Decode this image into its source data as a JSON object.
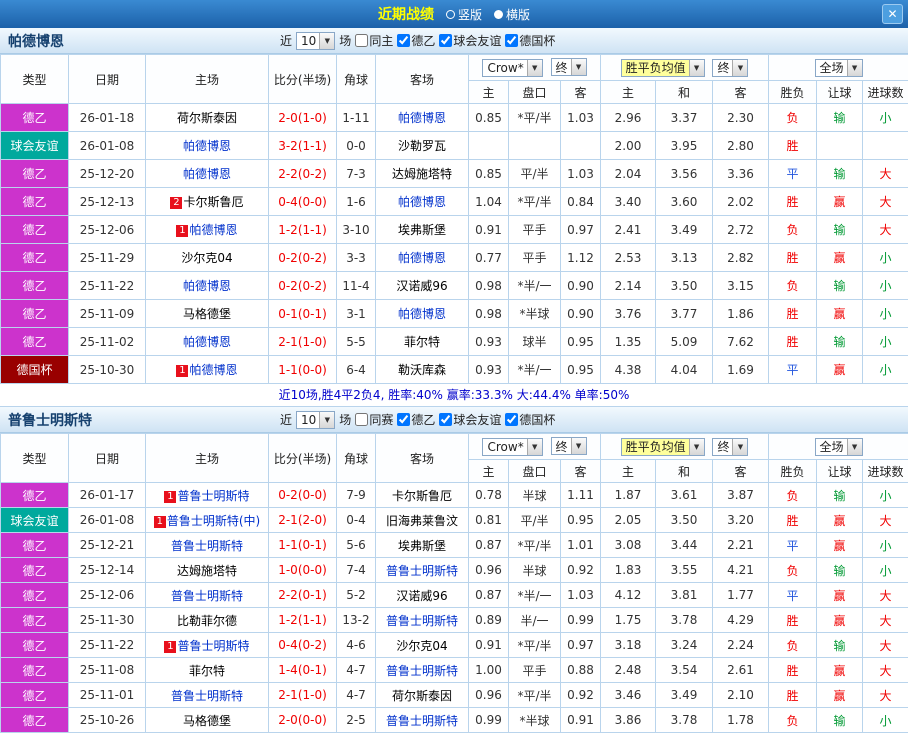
{
  "colors": {
    "accent_red": "#f00000",
    "accent_green": "#009933",
    "accent_blue": "#2255dd",
    "league_de2": "#cc33cc",
    "league_friendly": "#00a99d",
    "league_cup": "#990000",
    "focus_team": "#0030cc",
    "title_yellow": "#ffff00"
  },
  "titlebar": {
    "title": "近期战绩",
    "modes": [
      "竖版",
      "横版"
    ],
    "selected_mode": "横版",
    "close": "✕"
  },
  "controls": {
    "near": "近",
    "count": "10",
    "games": "场",
    "bookmaker": "Crow*",
    "final": "终",
    "wdl_avg": "胜平负均值",
    "full": "全场"
  },
  "columns": {
    "type": "类型",
    "date": "日期",
    "home": "主场",
    "score": "比分(半场)",
    "corner": "角球",
    "away": "客场",
    "ah_home": "主",
    "ah_line": "盘口",
    "ah_away": "客",
    "eu_home": "主",
    "eu_draw": "和",
    "eu_away": "客",
    "res_wdl": "胜负",
    "res_ah": "让球",
    "res_goal": "进球数"
  },
  "sections": [
    {
      "team": "帕德博恩",
      "same_label": "同主",
      "same_checked": false,
      "filters": [
        "德乙",
        "球会友谊",
        "德国杯"
      ],
      "filters_checked": [
        true,
        true,
        true
      ],
      "summary": "近10场,胜4平2负4, 胜率:40% 赢率:33.3% 大:44.4% 单率:50%",
      "rows": [
        {
          "type": "德乙",
          "date": "26-01-18",
          "home_rank": "",
          "home": "荷尔斯泰因",
          "home_focus": false,
          "score": "2-0(1-0)",
          "corner": "1-11",
          "away_rank": "",
          "away": "帕德博恩",
          "away_focus": true,
          "ah_home": "0.85",
          "ah_line": "*平/半",
          "ah_away": "1.03",
          "eu_home": "2.96",
          "eu_draw": "3.37",
          "eu_away": "2.30",
          "res_wdl": "负",
          "res_ah": "输",
          "res_goal": "小"
        },
        {
          "type": "球会友谊",
          "date": "26-01-08",
          "home_rank": "",
          "home": "帕德博恩",
          "home_focus": true,
          "score": "3-2(1-1)",
          "corner": "0-0",
          "away_rank": "",
          "away": "沙勒罗瓦",
          "away_focus": false,
          "ah_home": "",
          "ah_line": "",
          "ah_away": "",
          "eu_home": "2.00",
          "eu_draw": "3.95",
          "eu_away": "2.80",
          "res_wdl": "胜",
          "res_ah": "",
          "res_goal": ""
        },
        {
          "type": "德乙",
          "date": "25-12-20",
          "home_rank": "",
          "home": "帕德博恩",
          "home_focus": true,
          "score": "2-2(0-2)",
          "corner": "7-3",
          "away_rank": "",
          "away": "达姆施塔特",
          "away_focus": false,
          "ah_home": "0.85",
          "ah_line": "平/半",
          "ah_away": "1.03",
          "eu_home": "2.04",
          "eu_draw": "3.56",
          "eu_away": "3.36",
          "res_wdl": "平",
          "res_ah": "输",
          "res_goal": "大"
        },
        {
          "type": "德乙",
          "date": "25-12-13",
          "home_rank": "2",
          "home": "卡尔斯鲁厄",
          "home_focus": false,
          "score": "0-4(0-0)",
          "corner": "1-6",
          "away_rank": "",
          "away": "帕德博恩",
          "away_focus": true,
          "ah_home": "1.04",
          "ah_line": "*平/半",
          "ah_away": "0.84",
          "eu_home": "3.40",
          "eu_draw": "3.60",
          "eu_away": "2.02",
          "res_wdl": "胜",
          "res_ah": "赢",
          "res_goal": "大"
        },
        {
          "type": "德乙",
          "date": "25-12-06",
          "home_rank": "1",
          "home": "帕德博恩",
          "home_focus": true,
          "score": "1-2(1-1)",
          "corner": "3-10",
          "away_rank": "",
          "away": "埃弗斯堡",
          "away_focus": false,
          "ah_home": "0.91",
          "ah_line": "平手",
          "ah_away": "0.97",
          "eu_home": "2.41",
          "eu_draw": "3.49",
          "eu_away": "2.72",
          "res_wdl": "负",
          "res_ah": "输",
          "res_goal": "大"
        },
        {
          "type": "德乙",
          "date": "25-11-29",
          "home_rank": "",
          "home": "沙尔克04",
          "home_focus": false,
          "score": "0-2(0-2)",
          "corner": "3-3",
          "away_rank": "",
          "away": "帕德博恩",
          "away_focus": true,
          "ah_home": "0.77",
          "ah_line": "平手",
          "ah_away": "1.12",
          "eu_home": "2.53",
          "eu_draw": "3.13",
          "eu_away": "2.82",
          "res_wdl": "胜",
          "res_ah": "赢",
          "res_goal": "小"
        },
        {
          "type": "德乙",
          "date": "25-11-22",
          "home_rank": "",
          "home": "帕德博恩",
          "home_focus": true,
          "score": "0-2(0-2)",
          "corner": "11-4",
          "away_rank": "",
          "away": "汉诺威96",
          "away_focus": false,
          "ah_home": "0.98",
          "ah_line": "*半/一",
          "ah_away": "0.90",
          "eu_home": "2.14",
          "eu_draw": "3.50",
          "eu_away": "3.15",
          "res_wdl": "负",
          "res_ah": "输",
          "res_goal": "小"
        },
        {
          "type": "德乙",
          "date": "25-11-09",
          "home_rank": "",
          "home": "马格德堡",
          "home_focus": false,
          "score": "0-1(0-1)",
          "corner": "3-1",
          "away_rank": "",
          "away": "帕德博恩",
          "away_focus": true,
          "ah_home": "0.98",
          "ah_line": "*半球",
          "ah_away": "0.90",
          "eu_home": "3.76",
          "eu_draw": "3.77",
          "eu_away": "1.86",
          "res_wdl": "胜",
          "res_ah": "赢",
          "res_goal": "小"
        },
        {
          "type": "德乙",
          "date": "25-11-02",
          "home_rank": "",
          "home": "帕德博恩",
          "home_focus": true,
          "score": "2-1(1-0)",
          "corner": "5-5",
          "away_rank": "",
          "away": "菲尔特",
          "away_focus": false,
          "ah_home": "0.93",
          "ah_line": "球半",
          "ah_away": "0.95",
          "eu_home": "1.35",
          "eu_draw": "5.09",
          "eu_away": "7.62",
          "res_wdl": "胜",
          "res_ah": "输",
          "res_goal": "小"
        },
        {
          "type": "德国杯",
          "date": "25-10-30",
          "home_rank": "1",
          "home": "帕德博恩",
          "home_focus": true,
          "score": "1-1(0-0)",
          "corner": "6-4",
          "away_rank": "",
          "away": "勒沃库森",
          "away_focus": false,
          "ah_home": "0.93",
          "ah_line": "*半/一",
          "ah_away": "0.95",
          "eu_home": "4.38",
          "eu_draw": "4.04",
          "eu_away": "1.69",
          "res_wdl": "平",
          "res_ah": "赢",
          "res_goal": "小"
        }
      ]
    },
    {
      "team": "普鲁士明斯特",
      "same_label": "同赛",
      "same_checked": false,
      "filters": [
        "德乙",
        "球会友谊",
        "德国杯"
      ],
      "filters_checked": [
        true,
        true,
        true
      ],
      "rows": [
        {
          "type": "德乙",
          "date": "26-01-17",
          "home_rank": "1",
          "home": "普鲁士明斯特",
          "home_focus": true,
          "score": "0-2(0-0)",
          "corner": "7-9",
          "away_rank": "",
          "away": "卡尔斯鲁厄",
          "away_focus": false,
          "ah_home": "0.78",
          "ah_line": "半球",
          "ah_away": "1.11",
          "eu_home": "1.87",
          "eu_draw": "3.61",
          "eu_away": "3.87",
          "res_wdl": "负",
          "res_ah": "输",
          "res_goal": "小"
        },
        {
          "type": "球会友谊",
          "date": "26-01-08",
          "home_rank": "1",
          "home": "普鲁士明斯特(中)",
          "home_focus": true,
          "score": "2-1(2-0)",
          "corner": "0-4",
          "away_rank": "",
          "away": "旧海弗莱鲁汶",
          "away_focus": false,
          "ah_home": "0.81",
          "ah_line": "平/半",
          "ah_away": "0.95",
          "eu_home": "2.05",
          "eu_draw": "3.50",
          "eu_away": "3.20",
          "res_wdl": "胜",
          "res_ah": "赢",
          "res_goal": "大"
        },
        {
          "type": "德乙",
          "date": "25-12-21",
          "home_rank": "",
          "home": "普鲁士明斯特",
          "home_focus": true,
          "score": "1-1(0-1)",
          "corner": "5-6",
          "away_rank": "",
          "away": "埃弗斯堡",
          "away_focus": false,
          "ah_home": "0.87",
          "ah_line": "*平/半",
          "ah_away": "1.01",
          "eu_home": "3.08",
          "eu_draw": "3.44",
          "eu_away": "2.21",
          "res_wdl": "平",
          "res_ah": "赢",
          "res_goal": "小"
        },
        {
          "type": "德乙",
          "date": "25-12-14",
          "home_rank": "",
          "home": "达姆施塔特",
          "home_focus": false,
          "score": "1-0(0-0)",
          "corner": "7-4",
          "away_rank": "",
          "away": "普鲁士明斯特",
          "away_focus": true,
          "ah_home": "0.96",
          "ah_line": "半球",
          "ah_away": "0.92",
          "eu_home": "1.83",
          "eu_draw": "3.55",
          "eu_away": "4.21",
          "res_wdl": "负",
          "res_ah": "输",
          "res_goal": "小"
        },
        {
          "type": "德乙",
          "date": "25-12-06",
          "home_rank": "",
          "home": "普鲁士明斯特",
          "home_focus": true,
          "score": "2-2(0-1)",
          "corner": "5-2",
          "away_rank": "",
          "away": "汉诺威96",
          "away_focus": false,
          "ah_home": "0.87",
          "ah_line": "*半/一",
          "ah_away": "1.03",
          "eu_home": "4.12",
          "eu_draw": "3.81",
          "eu_away": "1.77",
          "res_wdl": "平",
          "res_ah": "赢",
          "res_goal": "大"
        },
        {
          "type": "德乙",
          "date": "25-11-30",
          "home_rank": "",
          "home": "比勒菲尔德",
          "home_focus": false,
          "score": "1-2(1-1)",
          "corner": "13-2",
          "away_rank": "",
          "away": "普鲁士明斯特",
          "away_focus": true,
          "ah_home": "0.89",
          "ah_line": "半/一",
          "ah_away": "0.99",
          "eu_home": "1.75",
          "eu_draw": "3.78",
          "eu_away": "4.29",
          "res_wdl": "胜",
          "res_ah": "赢",
          "res_goal": "大"
        },
        {
          "type": "德乙",
          "date": "25-11-22",
          "home_rank": "1",
          "home": "普鲁士明斯特",
          "home_focus": true,
          "score": "0-4(0-2)",
          "corner": "4-6",
          "away_rank": "",
          "away": "沙尔克04",
          "away_focus": false,
          "ah_home": "0.91",
          "ah_line": "*平/半",
          "ah_away": "0.97",
          "eu_home": "3.18",
          "eu_draw": "3.24",
          "eu_away": "2.24",
          "res_wdl": "负",
          "res_ah": "输",
          "res_goal": "大"
        },
        {
          "type": "德乙",
          "date": "25-11-08",
          "home_rank": "",
          "home": "菲尔特",
          "home_focus": false,
          "score": "1-4(0-1)",
          "corner": "4-7",
          "away_rank": "",
          "away": "普鲁士明斯特",
          "away_focus": true,
          "ah_home": "1.00",
          "ah_line": "平手",
          "ah_away": "0.88",
          "eu_home": "2.48",
          "eu_draw": "3.54",
          "eu_away": "2.61",
          "res_wdl": "胜",
          "res_ah": "赢",
          "res_goal": "大"
        },
        {
          "type": "德乙",
          "date": "25-11-01",
          "home_rank": "",
          "home": "普鲁士明斯特",
          "home_focus": true,
          "score": "2-1(1-0)",
          "corner": "4-7",
          "away_rank": "",
          "away": "荷尔斯泰因",
          "away_focus": false,
          "ah_home": "0.96",
          "ah_line": "*平/半",
          "ah_away": "0.92",
          "eu_home": "3.46",
          "eu_draw": "3.49",
          "eu_away": "2.10",
          "res_wdl": "胜",
          "res_ah": "赢",
          "res_goal": "大"
        },
        {
          "type": "德乙",
          "date": "25-10-26",
          "home_rank": "",
          "home": "马格德堡",
          "home_focus": false,
          "score": "2-0(0-0)",
          "corner": "2-5",
          "away_rank": "",
          "away": "普鲁士明斯特",
          "away_focus": true,
          "ah_home": "0.99",
          "ah_line": "*半球",
          "ah_away": "0.91",
          "eu_home": "3.86",
          "eu_draw": "3.78",
          "eu_away": "1.78",
          "res_wdl": "负",
          "res_ah": "输",
          "res_goal": "小"
        }
      ]
    }
  ]
}
